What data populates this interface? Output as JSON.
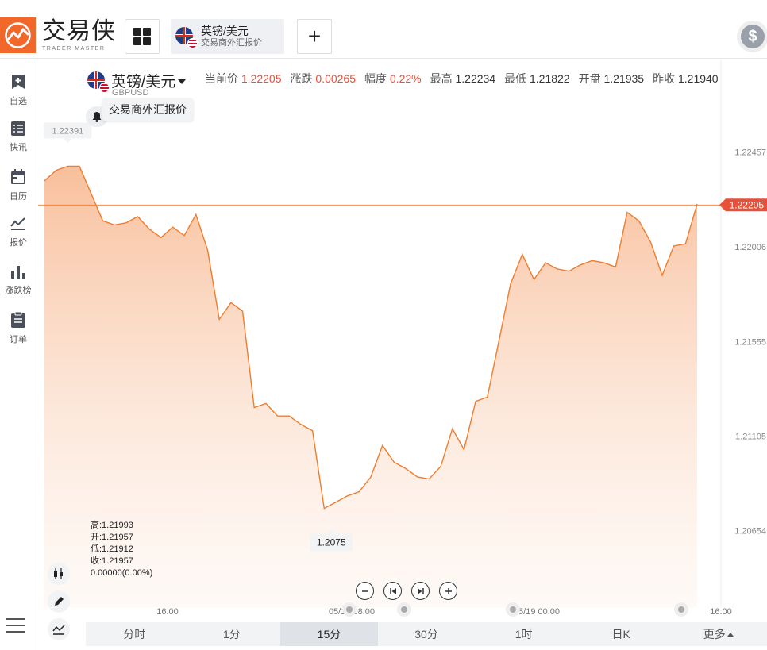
{
  "brand": {
    "name_cn": "交易侠",
    "name_en": "TRADER MASTER"
  },
  "tab": {
    "name": "英镑/美元",
    "subtitle": "交易商外汇报价"
  },
  "toolbar": {
    "add_label": "+",
    "account_icon": "$"
  },
  "sidebar": {
    "items": [
      {
        "label": "自选",
        "icon": "bookmark-add-icon"
      },
      {
        "label": "快讯",
        "icon": "news-list-icon"
      },
      {
        "label": "日历",
        "icon": "calendar-icon"
      },
      {
        "label": "报价",
        "icon": "line-chart-icon"
      },
      {
        "label": "涨跌榜",
        "icon": "bar-chart-icon"
      },
      {
        "label": "订单",
        "icon": "clipboard-icon"
      }
    ]
  },
  "symbol": {
    "name": "英镑/美元",
    "code": "GBPUSD",
    "tooltip": "交易商外汇报价"
  },
  "quote": {
    "current_label": "当前价",
    "current": "1.22205",
    "change_label": "涨跌",
    "change": "0.00265",
    "range_label": "幅度",
    "range": "0.22%",
    "high_label": "最高",
    "high": "1.22234",
    "low_label": "最低",
    "low": "1.21822",
    "open_label": "开盘",
    "open": "1.21935",
    "prev_label": "昨收",
    "prev": "1.21940"
  },
  "colors": {
    "line": "#f07c2d",
    "accent_red": "#e8503a"
  },
  "chart_data": {
    "type": "area",
    "y_ticks": [
      "1.22457",
      "1.22006",
      "1.21555",
      "1.21105",
      "1.20654"
    ],
    "x_ticks": [
      "16:00",
      "05/18 08:00",
      "05/19 00:00",
      "16:00"
    ],
    "current_price_label": "1.22205",
    "current_price": 1.22205,
    "max_label": "1.22391",
    "min_label": "1.2075",
    "ylim": [
      1.2029,
      1.2286
    ],
    "values": [
      1.2232,
      1.2237,
      1.2239,
      1.2239,
      1.2226,
      1.2213,
      1.2211,
      1.2212,
      1.2215,
      1.2209,
      1.2205,
      1.221,
      1.2206,
      1.2216,
      1.2199,
      1.2166,
      1.2174,
      1.217,
      1.2124,
      1.2126,
      1.212,
      1.212,
      1.2116,
      1.2113,
      1.2076,
      1.2079,
      1.2082,
      1.2084,
      1.2091,
      1.2106,
      1.2098,
      1.2095,
      1.2091,
      1.209,
      1.2096,
      1.2114,
      1.2104,
      1.2127,
      1.2129,
      1.2156,
      1.2183,
      1.2197,
      1.2185,
      1.2193,
      1.219,
      1.2189,
      1.2192,
      1.2194,
      1.2193,
      1.2191,
      1.2217,
      1.2213,
      1.2203,
      1.2187,
      1.2201,
      1.2202,
      1.2221
    ]
  },
  "ohlc": {
    "high": "高:1.21993",
    "open": "开:1.21957",
    "low": "低:1.21912",
    "close": "收:1.21957",
    "change": "0.00000(0.00%)"
  },
  "periods": [
    "分时",
    "1分",
    "15分",
    "30分",
    "1时",
    "日K",
    "更多"
  ],
  "active_period": "15分"
}
